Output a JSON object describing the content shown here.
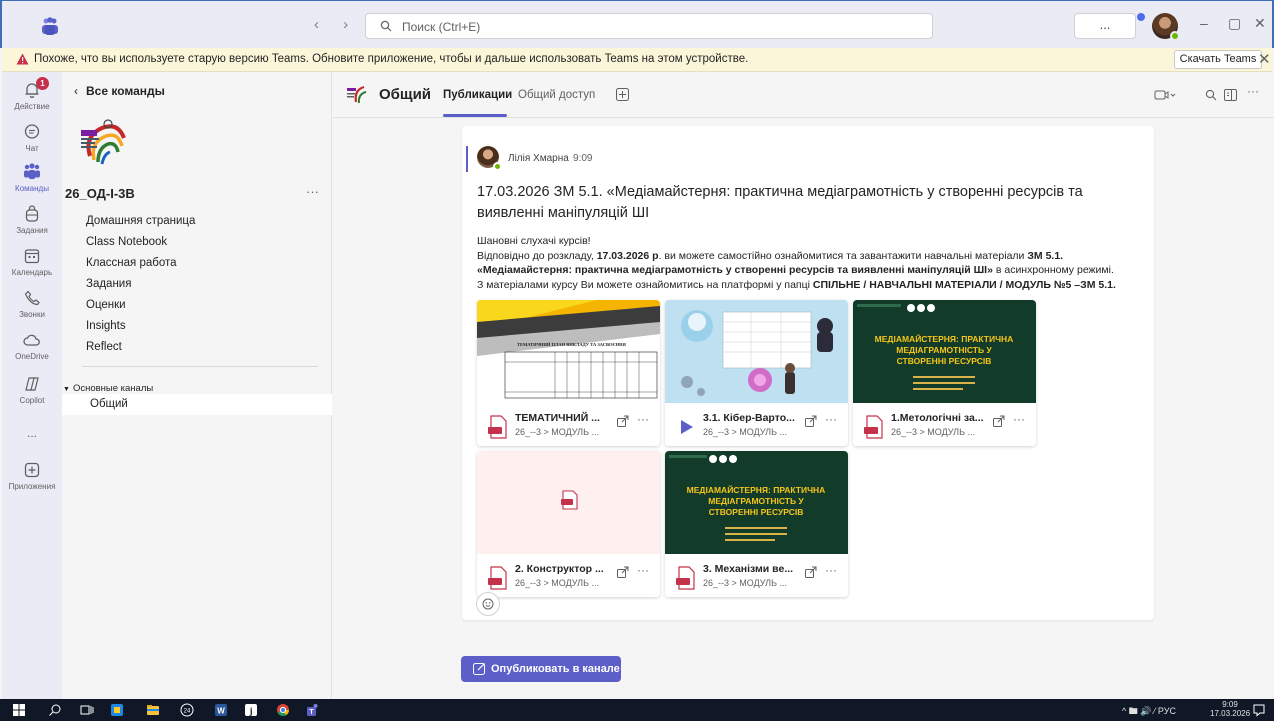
{
  "window": {
    "search_placeholder": "Поиск (Ctrl+E)",
    "more_label": "...",
    "nav_arrows": "‹ ›",
    "minimize": "–",
    "restore": "▢",
    "close": "✕"
  },
  "banner": {
    "text": "Похоже, что вы используете старую версию Teams. Обновите приложение, чтобы и дальше использовать Teams на этом устройстве.",
    "download_label": "Скачать Teams",
    "close": "✕"
  },
  "rail": {
    "items": [
      {
        "label": "Действие",
        "badge": "1"
      },
      {
        "label": "Чат"
      },
      {
        "label": "Команды"
      },
      {
        "label": "Задания"
      },
      {
        "label": "Календарь"
      },
      {
        "label": "Звонки"
      },
      {
        "label": "OneDrive"
      },
      {
        "label": "Copilot"
      },
      {
        "label": "..."
      },
      {
        "label": "Приложения"
      }
    ]
  },
  "leftpane": {
    "back_label": "Все команды",
    "team_name": "26_ОД-І-3В",
    "team_more": "···",
    "menu": [
      "Домашняя страница",
      "Class Notebook",
      "Классная работа",
      "Задания",
      "Оценки",
      "Insights",
      "Reflect"
    ],
    "channels_header": "Основные каналы",
    "active_channel": "Общий"
  },
  "channel": {
    "title": "Общий",
    "tabs": [
      "Публикации",
      "Общий доступ"
    ]
  },
  "post": {
    "author": "Лілія Хмарна",
    "time": "9:09",
    "title": "17.03.2026 ЗМ 5.1. «Медіамайстерня: практична медіаграмотність у створенні ресурсів та виявленні маніпуляцій ШІ",
    "line1": "Шановні слухачі курсів!",
    "line2_a": "Відповідно до розкладу, ",
    "line2_b": "17.03.2026 р",
    "line2_c": ". ви можете самостійно ознайомитися та завантажити навчальні матеріали ",
    "line2_d": "ЗМ 5.1.",
    "line3_a": "«Медіамайстерня: практична медіаграмотність у створенні ресурсів та виявленні маніпуляцій ШІ»",
    "line3_b": " в асинхронному режимі.",
    "line4_a": "З матеріалами курсу Ви можете ознайомитись на платформі у папці ",
    "line4_b": "СПІЛЬНЕ / НАВЧАЛЬНІ МАТЕРІАЛИ / МОДУЛЬ №5 –ЗМ 5.1.",
    "attachments": [
      {
        "name": "ТЕМАТИЧНИЙ ...",
        "path": "26_--3 > МОДУЛЬ ...",
        "type": "pdf"
      },
      {
        "name": "3.1. Кібер-Варто...",
        "path": "26_--3 > МОДУЛЬ ...",
        "type": "video"
      },
      {
        "name": "1.Метологічні за...",
        "path": "26_--3 > МОДУЛЬ ...",
        "type": "pdf"
      },
      {
        "name": "2. Конструктор ...",
        "path": "26_--3 > МОДУЛЬ ...",
        "type": "pdf"
      },
      {
        "name": "3. Механізми ве...",
        "path": "26_--3 > МОДУЛЬ ...",
        "type": "pdf"
      }
    ],
    "thumb_tematic": "ТЕМАТИЧНИЙ ПЛАН ВИКЛАДУ ТА ЗАСВОЄННЯ МАТЕРІАЛУ ДИСТАНЦІЙНОГО НАВЧАЛЬНОГО КУРСУ",
    "thumb_slide": "МЕДІАМАЙСТЕРНЯ: ПРАКТИЧНА МЕДІАГРАМОТНІСТЬ У СТВОРЕННІ РЕСУРСІВ"
  },
  "publish_label": "Опубликовать в канале",
  "taskbar": {
    "tray": "^ 🖿 🔊 ⁄ РУС",
    "time": "9:09",
    "date": "17.03.2026"
  },
  "colors": {
    "brand": "#5b5fc7",
    "rail_bg": "#ebebf5",
    "banner_bg": "#fbf6d9",
    "slide_green": "#123b2a",
    "pdf_red": "#c4314b"
  }
}
